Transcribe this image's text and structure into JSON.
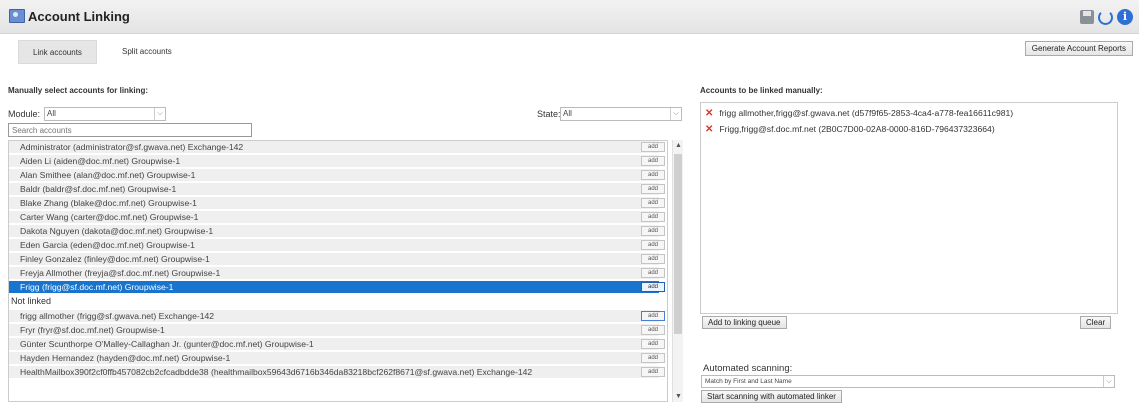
{
  "header": {
    "title": "Account Linking",
    "icons": [
      "account-linking-icon",
      "save-icon",
      "refresh-icon",
      "info-icon"
    ]
  },
  "tabs": [
    {
      "label": "Link accounts",
      "active": true
    },
    {
      "label": "Split accounts",
      "active": false
    }
  ],
  "toolbar": {
    "generate_reports_label": "Generate Account Reports"
  },
  "manual": {
    "heading": "Manually select accounts for linking:",
    "module_label": "Module:",
    "module_value": "All",
    "state_label": "State:",
    "state_value": "All",
    "search_placeholder": "Search accounts",
    "add_label": "add",
    "rows": [
      {
        "kind": "account",
        "text": "Administrator (administrator@sf.gwava.net) Exchange-142"
      },
      {
        "kind": "account",
        "text": "Aiden Li (aiden@doc.mf.net) Groupwise-1"
      },
      {
        "kind": "account",
        "text": "Alan Smithee (alan@doc.mf.net) Groupwise-1"
      },
      {
        "kind": "account",
        "text": "Baldr (baldr@sf.doc.mf.net) Groupwise-1"
      },
      {
        "kind": "account",
        "text": "Blake Zhang (blake@doc.mf.net) Groupwise-1"
      },
      {
        "kind": "account",
        "text": "Carter Wang (carter@doc.mf.net) Groupwise-1"
      },
      {
        "kind": "account",
        "text": "Dakota Nguyen (dakota@doc.mf.net) Groupwise-1"
      },
      {
        "kind": "account",
        "text": "Eden Garcia (eden@doc.mf.net) Groupwise-1"
      },
      {
        "kind": "account",
        "text": "Finley Gonzalez (finley@doc.mf.net) Groupwise-1"
      },
      {
        "kind": "account",
        "text": "Freyja Allmother (freyja@sf.doc.mf.net) Groupwise-1"
      },
      {
        "kind": "account",
        "text": "Frigg (frigg@sf.doc.mf.net) Groupwise-1",
        "selected": true
      },
      {
        "kind": "group",
        "text": "Not linked"
      },
      {
        "kind": "account",
        "text": "frigg allmother (frigg@sf.gwava.net) Exchange-142",
        "focused": true
      },
      {
        "kind": "account",
        "text": "Fryr (fryr@sf.doc.mf.net) Groupwise-1"
      },
      {
        "kind": "account",
        "text": "Günter Scunthorpe O'Malley-Callaghan Jr. (gunter@doc.mf.net) Groupwise-1"
      },
      {
        "kind": "account",
        "text": "Hayden Hernandez (hayden@doc.mf.net) Groupwise-1"
      },
      {
        "kind": "account",
        "text": "HealthMailbox390f2cf0ffb457082cb2cfcadbdde38 (healthmailbox59643d6716b346da83218bcf262f8671@sf.gwava.net) Exchange-142"
      }
    ]
  },
  "linked": {
    "heading": "Accounts to be linked manually:",
    "items": [
      "frigg allmother,frigg@sf.gwava.net (d57f9f65-2853-4ca4-a778-fea16611c981)",
      "Frigg,frigg@sf.doc.mf.net (2B0C7D00-02A8-0000-816D-796437323664)"
    ],
    "add_queue_label": "Add to linking queue",
    "clear_label": "Clear"
  },
  "automated": {
    "label": "Automated scanning:",
    "match_value": "Match by First and Last Name",
    "start_label": "Start scanning with automated linker"
  },
  "colors": {
    "selected_row": "#1874cd",
    "remove_x": "#d43a2a",
    "info_blue": "#2e6fd6"
  }
}
